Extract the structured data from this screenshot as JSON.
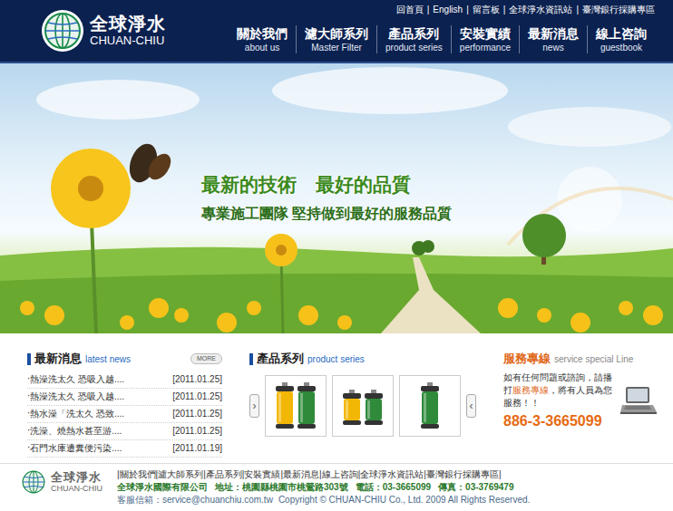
{
  "header": {
    "logo": {
      "name": "全球淨水",
      "english": "CHUAN-CHIU"
    },
    "top_links": [
      "回首頁",
      "English",
      "留言板",
      "全球淨水資訊站",
      "臺灣銀行採購專區"
    ],
    "top_separator": "|",
    "nav": [
      {
        "label": "關於我們",
        "sub": "about us"
      },
      {
        "label": "濾大師系列",
        "sub": "Master Filter"
      },
      {
        "label": "產品系列",
        "sub": "product series"
      },
      {
        "label": "安裝實績",
        "sub": "performance"
      },
      {
        "label": "最新消息",
        "sub": "news"
      },
      {
        "label": "線上咨詢",
        "sub": "guestbook"
      }
    ]
  },
  "banner": {
    "headline": "最新的技術　最好的品質",
    "subline": "專業施工團隊 堅持做到最好的服務品質"
  },
  "news": {
    "title": "最新消息",
    "subtitle": "latest news",
    "more": "MORE",
    "bullet": "‧",
    "items": [
      {
        "title": "熱澡洗太久 恐吸入越....",
        "date": "[2011.01.25]"
      },
      {
        "title": "熱澡洗太久 恐吸入越....",
        "date": "[2011.01.25]"
      },
      {
        "title": "熱水澡「洗太久 恐致....",
        "date": "[2011.01.25]"
      },
      {
        "title": "洗澡、燒熱水甚至游....",
        "date": "[2011.01.25]"
      },
      {
        "title": "石門水庫遭糞便污染....",
        "date": "[2011.01.19]"
      }
    ]
  },
  "products": {
    "title": "產品系列",
    "subtitle": "product series",
    "prev": "›",
    "next": "‹",
    "items": [
      {
        "kind": "tall",
        "filters": [
          "#f2b705",
          "#2f8a3a"
        ]
      },
      {
        "kind": "short",
        "filters": [
          "#f2b705",
          "#2f8a3a"
        ]
      },
      {
        "kind": "tall",
        "filters": [
          "#2f8a3a"
        ]
      }
    ]
  },
  "service": {
    "title": "服務專線",
    "subtitle": "service special Line",
    "text_before": "如有任何問題或諮詢，請播打",
    "highlight": "服務專線",
    "text_after": "，將有人員為您服務！！",
    "phone": "886-3-3665099"
  },
  "footer": {
    "logo": {
      "name": "全球淨水",
      "english": "CHUAN-CHIU"
    },
    "separator": "|",
    "links": [
      "關於我們",
      "濾大師系列",
      "產品系列",
      "安裝實績",
      "最新消息",
      "線上咨詢",
      "全球淨水資訊站",
      "臺灣銀行採購專區"
    ],
    "company": "全球淨水國際有限公司",
    "address": "地址：桃園縣桃園市桃鶯路303號",
    "tel": "電話：03-3665099",
    "fax": "傳真：03-3769479",
    "email_label": "客服信箱：",
    "email": "service@chuanchiu.com.tw",
    "copyright": "Copyright © CHUAN-CHIU Co., Ltd. 2009 All Rights Reserved."
  }
}
